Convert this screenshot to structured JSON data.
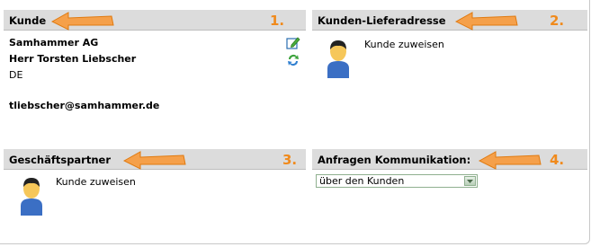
{
  "panels": {
    "kunde": {
      "title": "Kunde",
      "number": "1.",
      "company": "Samhammer AG",
      "contact": "Herr Torsten Liebscher",
      "country": "DE",
      "email": "tliebscher@samhammer.de"
    },
    "lieferadresse": {
      "title": "Kunden-Lieferadresse",
      "number": "2.",
      "assign_label": "Kunde zuweisen"
    },
    "geschaeftspartner": {
      "title": "Geschäftspartner",
      "number": "3.",
      "assign_label": "Kunde zuweisen"
    },
    "kommunikation": {
      "title": "Anfragen Kommunikation:",
      "number": "4.",
      "select_value": "über den Kunden"
    }
  },
  "icons": {
    "edit": "edit-icon",
    "refresh": "refresh-icon",
    "user": "user-icon",
    "arrow": "orange-arrow-icon"
  },
  "colors": {
    "header_bg": "#dcdcdc",
    "accent_orange": "#f08a1c"
  }
}
